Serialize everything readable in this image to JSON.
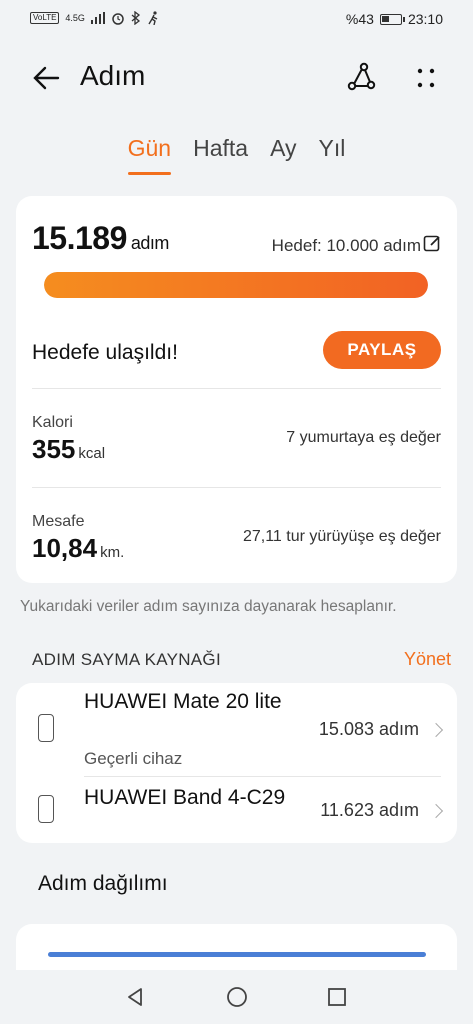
{
  "status": {
    "network_tags": [
      "VoLTE",
      "4.5G"
    ],
    "battery_text": "%43",
    "battery_level": 0.43,
    "time": "23:10"
  },
  "header": {
    "title": "Adım"
  },
  "tabs": [
    {
      "label": "Gün",
      "active": true
    },
    {
      "label": "Hafta",
      "active": false
    },
    {
      "label": "Ay",
      "active": false
    },
    {
      "label": "Yıl",
      "active": false
    }
  ],
  "summary": {
    "steps": "15.189",
    "steps_unit": "adım",
    "goal": "Hedef: 10.000 adım",
    "progress": 1.0,
    "goal_reached": "Hedefe ulaşıldı!",
    "share_label": "PAYLAŞ",
    "calorie_label": "Kalori",
    "calorie_value": "355",
    "calorie_unit": "kcal",
    "calorie_equiv": "7 yumurtaya eş değer",
    "distance_label": "Mesafe",
    "distance_value": "10,84",
    "distance_unit": "km.",
    "distance_equiv": "27,11 tur yürüyüşe eş değer"
  },
  "note": "Yukarıdaki veriler adım sayınıza dayanarak hesaplanır.",
  "source": {
    "heading": "ADIM SAYMA KAYNAĞI",
    "manage_label": "Yönet",
    "devices": [
      {
        "name": "HUAWEI Mate 20 lite",
        "sub": "Geçerli cihaz",
        "steps": "15.083 adım"
      },
      {
        "name": "HUAWEI Band 4-C29",
        "sub": "",
        "steps": "11.623 adım"
      }
    ]
  },
  "distribution": {
    "title": "Adım dağılımı"
  },
  "colors": {
    "accent": "#f26f1d",
    "bar_start": "#f58d1f",
    "bar_end": "#f26224",
    "chart_line": "#4a7fd6"
  },
  "icons": [
    "back-arrow-icon",
    "route-icon",
    "more-icon",
    "edit-icon",
    "phone-icon",
    "chevron-right-icon",
    "nav-back-icon",
    "nav-home-icon",
    "nav-recents-icon"
  ]
}
